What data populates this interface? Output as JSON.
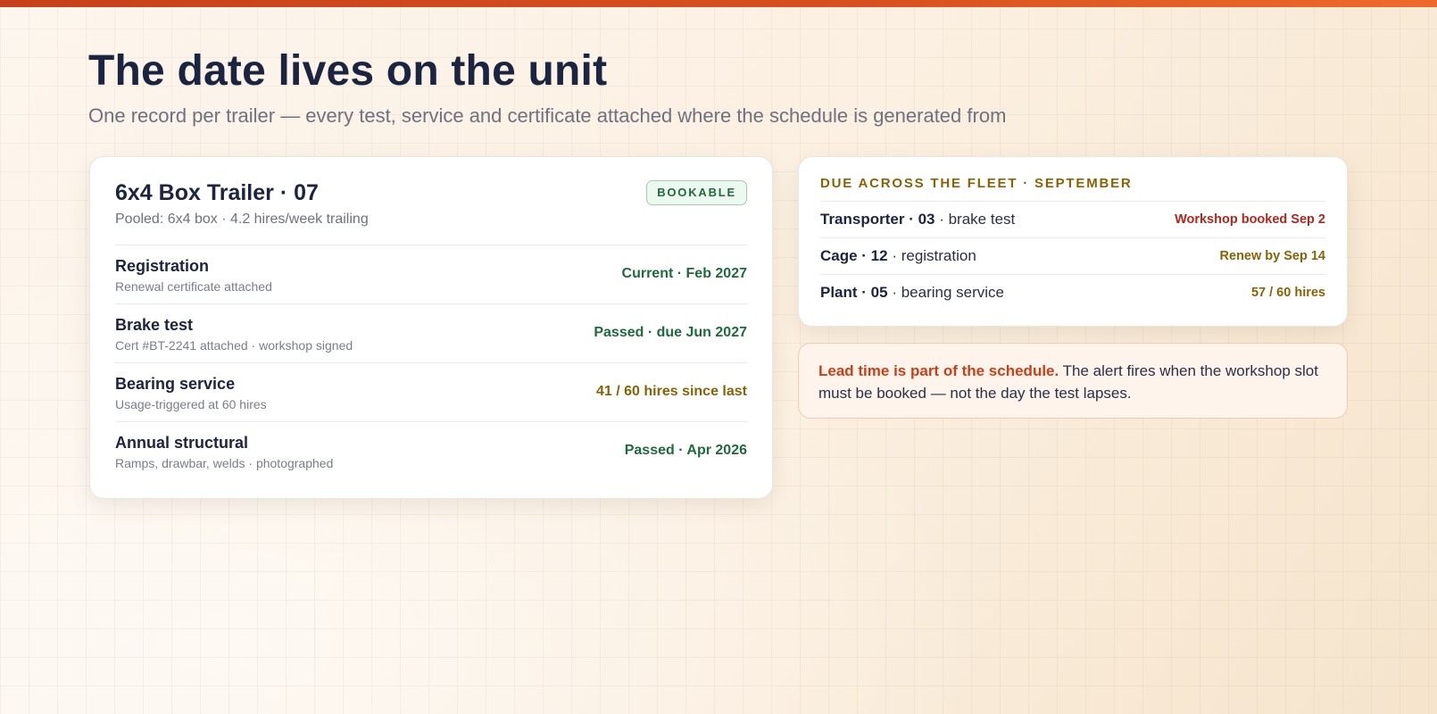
{
  "page": {
    "title": "The date lives on the unit",
    "subtitle": "One record per trailer — every test, service and certificate attached where the schedule is generated from"
  },
  "unit": {
    "name": "6x4 Box Trailer · 07",
    "meta": "Pooled: 6x4 box · 4.2 hires/week trailing",
    "badge": "BOOKABLE",
    "records": [
      {
        "name": "Registration",
        "note": "Renewal certificate attached",
        "status": "Current · Feb 2027",
        "tone": "green"
      },
      {
        "name": "Brake test",
        "note": "Cert #BT-2241 attached · workshop signed",
        "status": "Passed · due Jun 2027",
        "tone": "green"
      },
      {
        "name": "Bearing service",
        "note": "Usage-triggered at 60 hires",
        "status": "41 / 60 hires since last",
        "tone": "amber"
      },
      {
        "name": "Annual structural",
        "note": "Ramps, drawbar, welds · photographed",
        "status": "Passed · Apr 2026",
        "tone": "green"
      }
    ]
  },
  "fleet": {
    "heading": "DUE ACROSS THE FLEET · SEPTEMBER",
    "rows": [
      {
        "unit": "Transporter · 03",
        "task": " · brake test",
        "status": "Workshop booked Sep 2",
        "tone": "red"
      },
      {
        "unit": "Cage · 12",
        "task": " · registration",
        "status": "Renew by Sep 14",
        "tone": "amber"
      },
      {
        "unit": "Plant · 05",
        "task": " · bearing service",
        "status": "57 / 60 hires",
        "tone": "amber"
      }
    ]
  },
  "callout": {
    "lead": "Lead time is part of the schedule.",
    "body": " The alert fires when the workshop slot must be booked — not the day the test lapses."
  },
  "colors": {
    "accent": "#d9501f",
    "status_green": "#1d6b3a",
    "status_amber": "#8a6205",
    "status_red": "#b3261e",
    "ink": "#1b2440"
  }
}
